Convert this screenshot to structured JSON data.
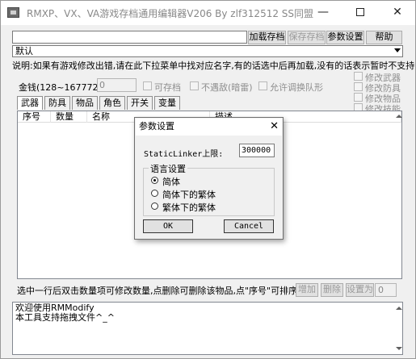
{
  "window": {
    "title": "RMXP、VX、VA游戏存档通用编辑器V206 By zlf312512 SS同盟",
    "min_glyph": "—",
    "close_glyph": "✕"
  },
  "toolbar": {
    "path_value": "",
    "load_label": "加载存档",
    "save_label": "保存存档",
    "settings_label": "参数设置",
    "help_label": "帮助"
  },
  "preset": {
    "selected": "默认"
  },
  "instructions": "说明:如果有游戏修改出错,请在此下拉菜单中找对应名字,有的话选中后再加载,没有的话表示暂时不支持",
  "money": {
    "label": "金钱(128~16777215)",
    "value": "0",
    "saveable_label": "可存档",
    "no_encounter_label": "不遇敌(暗雷)",
    "allow_swap_label": "允许调换队形"
  },
  "modify_options": [
    "修改武器",
    "修改防具",
    "修改物品",
    "修改技能"
  ],
  "tabs": [
    "武器",
    "防具",
    "物品",
    "角色",
    "开关",
    "变量"
  ],
  "list": {
    "columns": [
      "序号",
      "数量",
      "名称",
      "描述"
    ]
  },
  "bottom": {
    "hint": "选中一行后双击数量项可修改数量,点删除可删除该物品,点\"序号\"可排序",
    "add_label": "增加",
    "delete_label": "删除",
    "set_label": "设置为",
    "set_value": "0"
  },
  "log": {
    "line1": "欢迎使用RMModify",
    "line2": "本工具支持拖拽文件^_^"
  },
  "dialog": {
    "title": "参数设置",
    "close_glyph": "✕",
    "limit_label": "StaticLinker上限:",
    "limit_value": "300000",
    "group_label": "语言设置",
    "options": [
      "简体",
      "简体下的繁体",
      "繁体下的繁体"
    ],
    "selected_index": 0,
    "ok_label": "OK",
    "cancel_label": "Cancel"
  }
}
